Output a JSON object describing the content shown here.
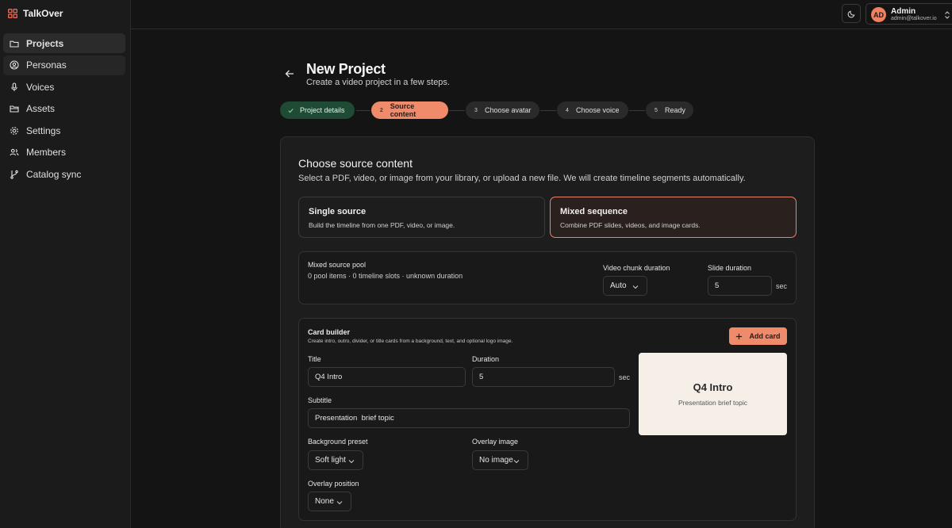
{
  "app": {
    "name": "TalkOver"
  },
  "sidebar": {
    "items": [
      {
        "label": "Projects",
        "icon": "folder-icon"
      },
      {
        "label": "Personas",
        "icon": "user-circle-icon"
      },
      {
        "label": "Voices",
        "icon": "microphone-icon"
      },
      {
        "label": "Assets",
        "icon": "folder-open-icon"
      },
      {
        "label": "Settings",
        "icon": "gear-icon"
      },
      {
        "label": "Members",
        "icon": "users-icon"
      },
      {
        "label": "Catalog sync",
        "icon": "git-branch-icon"
      }
    ]
  },
  "user": {
    "initials": "AD",
    "name": "Admin",
    "email": "admin@talkover.io"
  },
  "header": {
    "title": "New Project",
    "subtitle": "Create a video project in a few steps."
  },
  "stepper": {
    "steps": [
      {
        "num": "",
        "label": "Project details",
        "state": "done"
      },
      {
        "num": "2",
        "label": "Source content",
        "state": "current"
      },
      {
        "num": "3",
        "label": "Choose avatar",
        "state": "upcoming"
      },
      {
        "num": "4",
        "label": "Choose voice",
        "state": "upcoming"
      },
      {
        "num": "5",
        "label": "Ready",
        "state": "upcoming"
      }
    ]
  },
  "source": {
    "title": "Choose source content",
    "description": "Select a PDF, video, or image from your library, or upload a new file. We will create timeline segments automatically.",
    "options": [
      {
        "title": "Single source",
        "description": "Build the timeline from one PDF, video, or image.",
        "selected": false
      },
      {
        "title": "Mixed sequence",
        "description": "Combine PDF slides, videos, and image cards.",
        "selected": true
      }
    ]
  },
  "pool": {
    "title": "Mixed source pool",
    "meta": "0 pool items · 0 timeline slots · unknown duration",
    "video_chunk_label": "Video chunk duration",
    "video_chunk_value": "Auto",
    "slide_label": "Slide duration",
    "slide_value": "5",
    "unit": "sec"
  },
  "builder": {
    "title": "Card builder",
    "description": "Create intro, outro, divider, or title cards from a background, text, and optional logo image.",
    "add_label": "Add card",
    "title_label": "Title",
    "title_value": "Q4 Intro",
    "duration_label": "Duration",
    "duration_value": "5",
    "unit": "sec",
    "subtitle_label": "Subtitle",
    "subtitle_value": "Presentation  brief topic",
    "bg_label": "Background preset",
    "bg_value": "Soft light",
    "overlay_label": "Overlay image",
    "overlay_value": "No image",
    "position_label": "Overlay position",
    "position_value": "None",
    "preview": {
      "title": "Q4 Intro",
      "subtitle": "Presentation brief topic"
    }
  },
  "colors": {
    "accent": "#ef8a6a",
    "success": "#1f4a34",
    "background": "#141414"
  }
}
